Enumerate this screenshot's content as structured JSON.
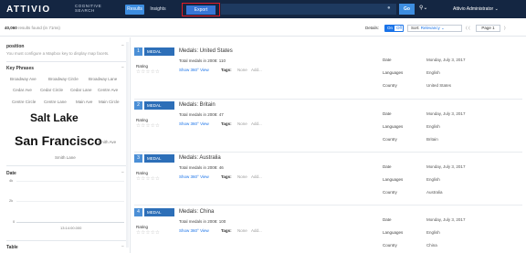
{
  "header": {
    "logo": "ATTIVIO",
    "logo_sub1": "COGNITIVE",
    "logo_sub2": "SEARCH",
    "tabs": [
      "Results",
      "Insights"
    ],
    "export_label": "Export",
    "search_value": "",
    "go_label": "Go",
    "user": "Attivio Administrator ⌄"
  },
  "resultsbar": {
    "count": "40,060",
    "count_suffix": "results found",
    "time": "(in 71ms)",
    "details_label": "Details:",
    "on": "On",
    "off": "Off",
    "sort_label": "Sort:",
    "sort_value": "Relevancy ⌄",
    "prev": "⟨ ⟨",
    "page": "Page 1",
    "next": "⟩"
  },
  "sidebar": {
    "position_title": "position",
    "position_msg": "You must configure a Mapbox key to display map facets.",
    "key_phrases_title": "Key Phrases",
    "phrases": [
      "Broadway Ave",
      "Broadway Circle",
      "Broadway Lane",
      "Cedar Ave",
      "Cedar Circle",
      "Cedar Lane",
      "Centre Ave",
      "Centre Circle",
      "Centre Lane",
      "Main Ave",
      "Main Circle",
      "Salt Lake",
      "San Francisco",
      "Smith Ave",
      "Smith Lane"
    ],
    "date_title": "Date",
    "date_y": [
      "4k",
      "2k",
      "0"
    ],
    "date_x": "13:14:00.000",
    "table_title": "Table"
  },
  "results": [
    {
      "n": "1",
      "type": "MEDAL",
      "title": "Medals: United States",
      "total": "Total medals in 2008: 110",
      "date": "Monday, July 3, 2017",
      "language": "English",
      "country": "United States"
    },
    {
      "n": "2",
      "type": "MEDAL",
      "title": "Medals: Britain",
      "total": "Total medals in 2008: 47",
      "date": "Monday, July 3, 2017",
      "language": "English",
      "country": "Britain"
    },
    {
      "n": "3",
      "type": "MEDAL",
      "title": "Medals: Australia",
      "total": "Total medals in 2008: 46",
      "date": "Monday, July 3, 2017",
      "language": "English",
      "country": "Australia"
    },
    {
      "n": "4",
      "type": "MEDAL",
      "title": "Medals: China",
      "total": "Total medals in 2008: 100",
      "date": "Monday, July 3, 2017",
      "language": "English",
      "country": "China"
    }
  ],
  "labels": {
    "rating": "Rating",
    "stars": "☆☆☆☆☆",
    "show360": "Show 360° View",
    "tags": "Tags:",
    "none": "None",
    "add": "Add...",
    "date": "Date",
    "languages": "Languages",
    "country": "Country"
  },
  "colors": {
    "nav_bg": "#142642",
    "accent": "#3d8de0",
    "export_highlight": "#e01c24",
    "badge": "#2d6fb8"
  }
}
